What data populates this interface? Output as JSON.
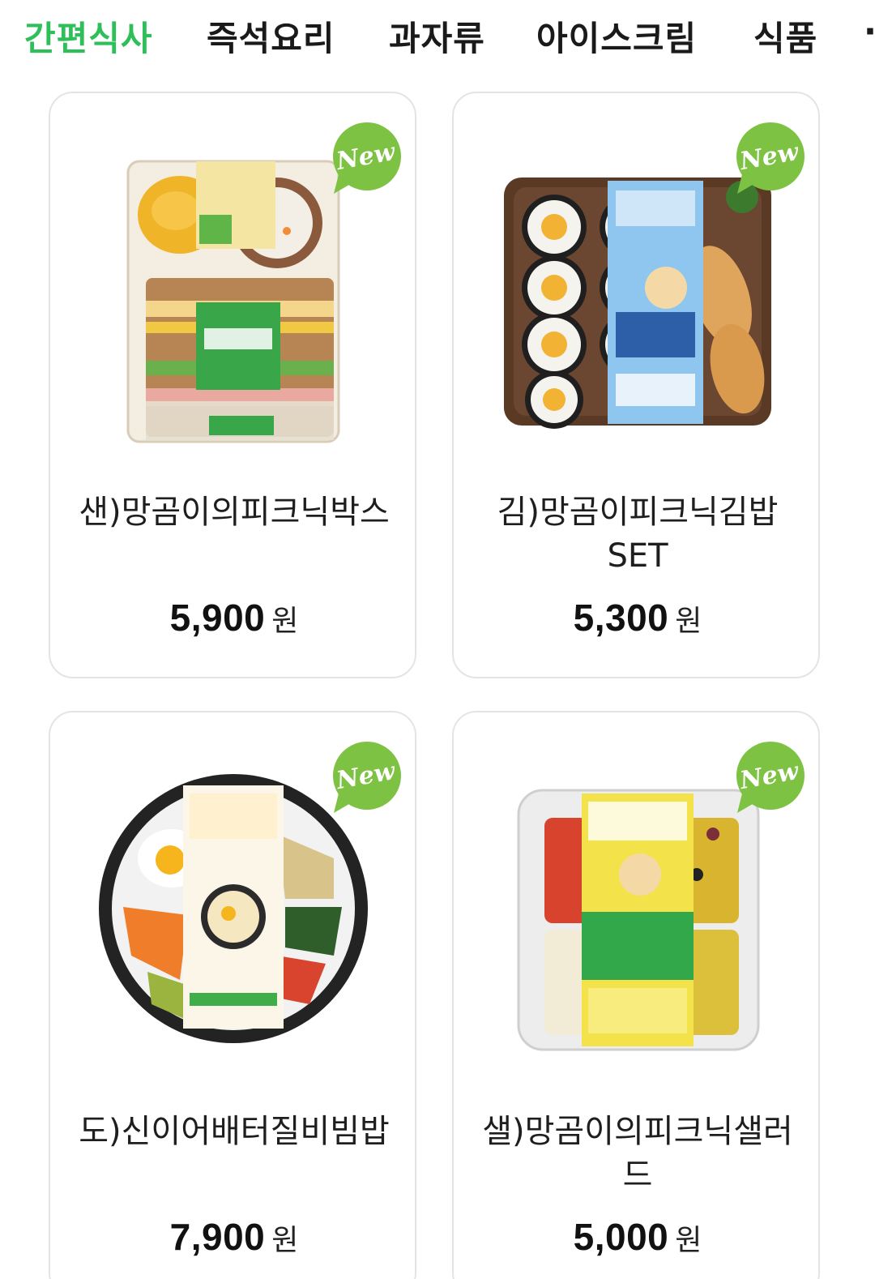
{
  "category_tabs": [
    {
      "label": "간편식사",
      "active": true
    },
    {
      "label": "즉석요리",
      "active": false
    },
    {
      "label": "과자류",
      "active": false
    },
    {
      "label": "아이스크림",
      "active": false
    },
    {
      "label": "식품",
      "active": false
    }
  ],
  "new_badge_label": "New",
  "products": [
    {
      "name": "샌)망곰이의피크닉박스",
      "price": "5,900",
      "currency": "원",
      "badge": "New",
      "image_icon": "picnic-box-sandwich-image"
    },
    {
      "name": "김)망곰이피크닉김밥SET",
      "price": "5,300",
      "currency": "원",
      "badge": "New",
      "image_icon": "gimbap-set-image"
    },
    {
      "name": "도)신이어배터질비빔밥",
      "price": "7,900",
      "currency": "원",
      "badge": "New",
      "image_icon": "bibimbap-bowl-image"
    },
    {
      "name": "샐)망곰이의피크닉샐러드",
      "price": "5,000",
      "currency": "원",
      "badge": "New",
      "image_icon": "picnic-salad-image"
    }
  ],
  "colors": {
    "active_tab": "#2fbf5a",
    "badge": "#7dc242",
    "card_border": "#e4e4e4"
  }
}
